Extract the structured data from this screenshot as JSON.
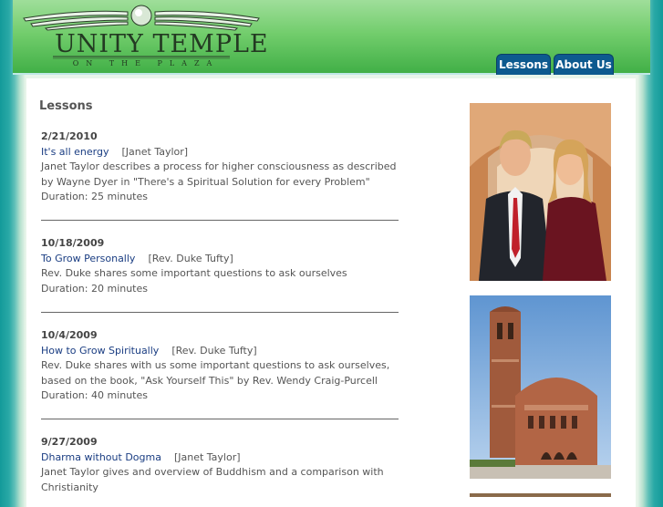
{
  "header": {
    "logo_title": "UNITY TEMPLE",
    "logo_subtitle": "ON THE PLAZA",
    "nav": [
      {
        "label": "Lessons"
      },
      {
        "label": "About Us"
      }
    ]
  },
  "page_title": "Lessons",
  "lessons": [
    {
      "date": "2/21/2010",
      "title": "It's all energy",
      "author": "[Janet Taylor]",
      "desc1": "Janet Taylor describes a process for higher consciousness as described",
      "desc2": "by Wayne Dyer in \"There's a Spiritual Solution for every Problem\"",
      "duration": "Duration: 25 minutes"
    },
    {
      "date": "10/18/2009",
      "title": "To Grow Personally",
      "author": "[Rev. Duke Tufty]",
      "desc1": "Rev. Duke shares some important questions to ask ourselves",
      "duration": "Duration: 20 minutes"
    },
    {
      "date": "10/4/2009",
      "title": "How to Grow Spiritually",
      "author": "[Rev. Duke Tufty]",
      "desc1": "Rev. Duke shares with us some important questions to ask ourselves,",
      "desc2": "based on the book, \"Ask Yourself This\" by Rev. Wendy Craig-Purcell",
      "duration": "Duration: 40 minutes"
    },
    {
      "date": "9/27/2009",
      "title": "Dharma without Dogma",
      "author": "[Janet Taylor]",
      "desc1": "Janet Taylor gives and overview of Buddhism and a comparison with",
      "desc2": "Christianity"
    }
  ],
  "colors": {
    "nav_bg": "#0d5a8f",
    "link": "#1a3d82",
    "header_green": "#5cc25a",
    "frame_teal": "#139a9a"
  }
}
